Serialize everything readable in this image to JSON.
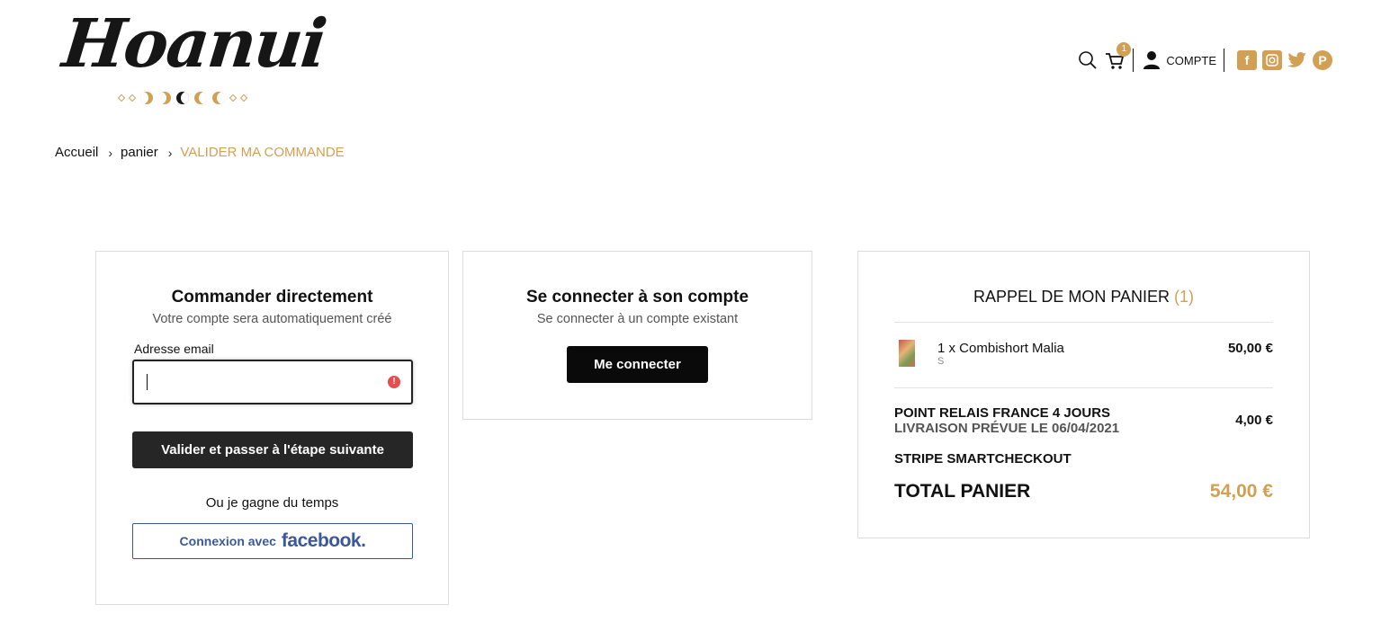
{
  "brand": {
    "logo_text": "Hoanui",
    "accent_color": "#d2a054"
  },
  "header": {
    "cart_count": "1",
    "account_label": "COMPTE",
    "icons": [
      "search-icon",
      "cart-icon",
      "user-icon",
      "facebook-icon",
      "instagram-icon",
      "twitter-icon",
      "pinterest-icon"
    ]
  },
  "breadcrumb": {
    "home": "Accueil",
    "cart": "panier",
    "current": "VALIDER MA COMMANDE"
  },
  "direct_order": {
    "title": "Commander directement",
    "subtitle": "Votre compte sera automatiquement créé",
    "email_label": "Adresse email",
    "email_value": "",
    "submit_label": "Valider et passer à l'étape suivante",
    "or_text": "Ou je gagne du temps",
    "facebook_prefix": "Connexion avec",
    "facebook_brand": "facebook."
  },
  "login": {
    "title": "Se connecter à son compte",
    "subtitle": "Se connecter à un compte existant",
    "button_label": "Me connecter"
  },
  "cart_summary": {
    "title": "RAPPEL DE MON PANIER",
    "count": "(1)",
    "items": [
      {
        "name": "1 x Combishort Malia",
        "size": "S",
        "price": "50,00  €"
      }
    ],
    "shipping_title": "POINT RELAIS FRANCE 4 JOURS",
    "shipping_date": "LIVRAISON PRÉVUE LE 06/04/2021",
    "shipping_price": "4,00 €",
    "payment_method": "STRIPE SMARTCHECKOUT",
    "total_label": "TOTAL PANIER",
    "total_value": "54,00 €"
  }
}
